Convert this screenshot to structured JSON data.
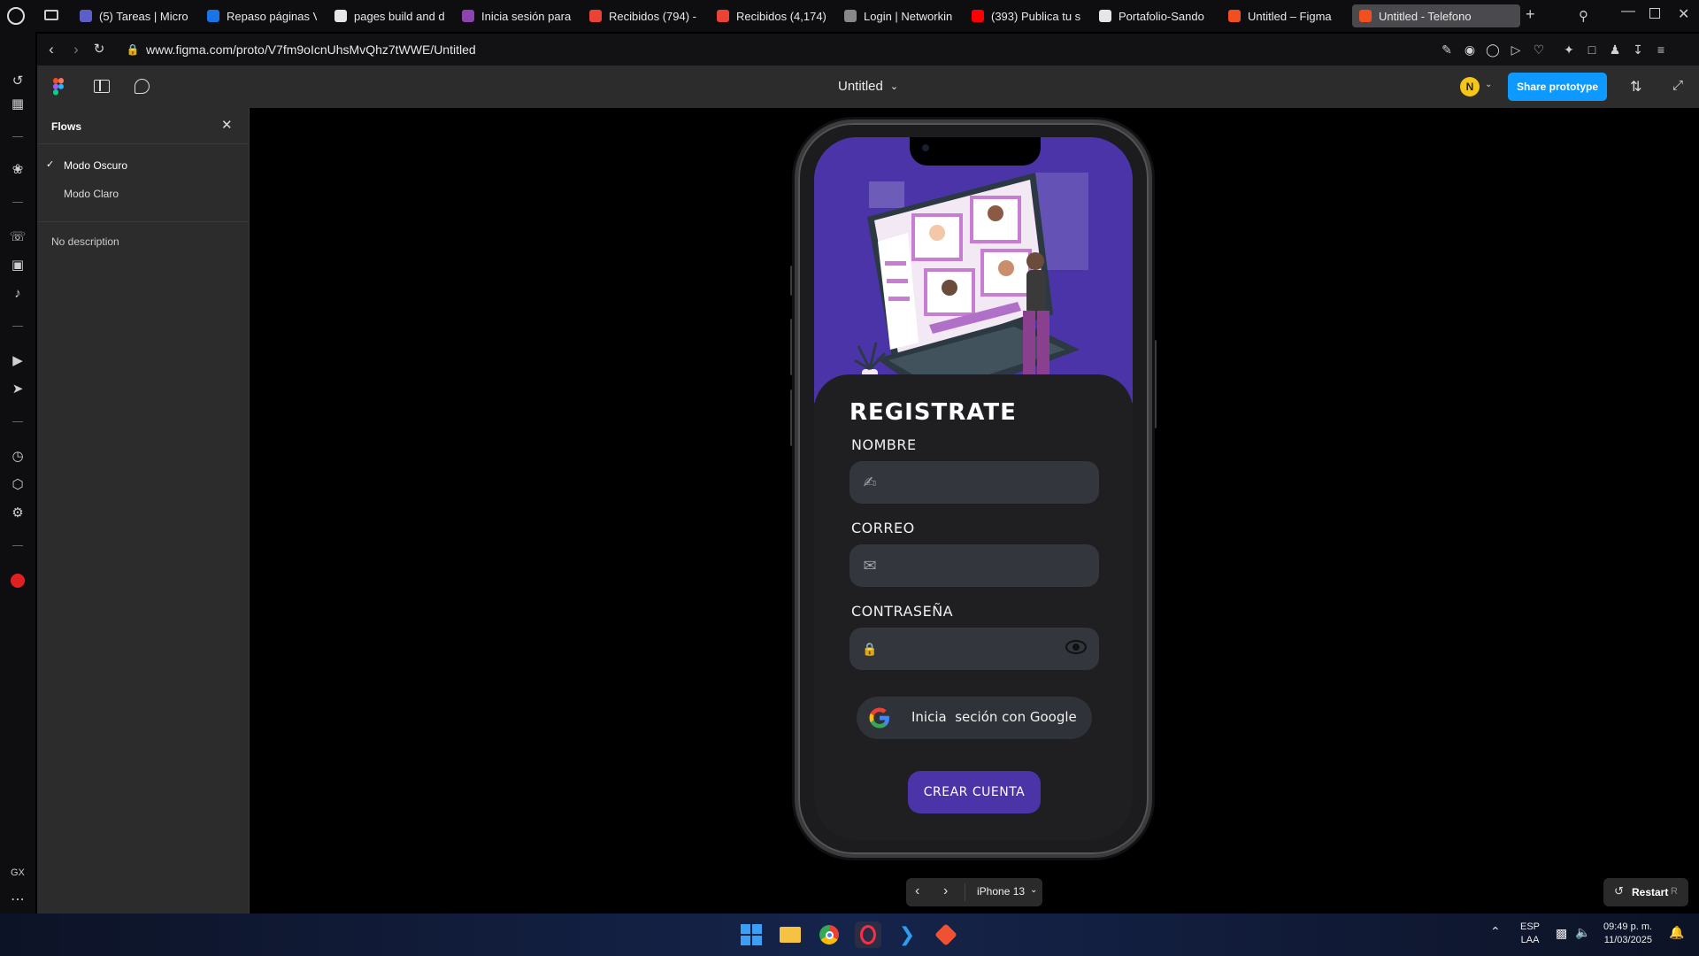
{
  "browser": {
    "tabs": [
      {
        "label": "(5) Tareas | Micro",
        "color": "#5b5fc7"
      },
      {
        "label": "Repaso páginas V",
        "color": "#1a73e8"
      },
      {
        "label": "pages build and d",
        "color": "#e6e6e6"
      },
      {
        "label": "Inicia sesión para",
        "color": "#8e44ad"
      },
      {
        "label": "Recibidos (794) -",
        "color": "#ea4335"
      },
      {
        "label": "Recibidos (4,174)",
        "color": "#ea4335"
      },
      {
        "label": "Login | Networkin",
        "color": "#888888"
      },
      {
        "label": "(393) Publica tu s",
        "color": "#ff0000"
      },
      {
        "label": "Portafolio-Sando",
        "color": "#e6e6e6"
      },
      {
        "label": "Untitled – Figma",
        "color": "#f24e1e"
      },
      {
        "label": "Untitled - Telefono",
        "color": "#f24e1e"
      }
    ],
    "url": "www.figma.com/proto/V7fm9oIcnUhsMvQhz7tWWE/Untitled",
    "new_tab_label": "+"
  },
  "figma": {
    "file_title": "Untitled",
    "avatar_initial": "N",
    "share_label": "Share prototype",
    "flows_title": "Flows",
    "flows": [
      {
        "label": "Modo Oscuro",
        "selected": true
      },
      {
        "label": "Modo Claro",
        "selected": false
      }
    ],
    "description": "No description",
    "device_label": "iPhone 13",
    "restart_label": "Restart",
    "restart_shortcut": "R"
  },
  "app": {
    "title": "REGISTRATE",
    "name_label": "NOMBRE",
    "email_label": "CORREO",
    "password_label": "CONTRASEÑA",
    "google_label": "Inicia  seción con Google",
    "create_label": "CREAR CUENTA",
    "colors": {
      "hero": "#4a34a8",
      "button": "#4a34a8",
      "field": "#33363d",
      "bg": "#1f1f21"
    }
  },
  "taskbar": {
    "lang_top": "ESP",
    "lang_bottom": "LAA",
    "time": "09:49 p. m.",
    "date": "11/03/2025"
  },
  "sidebar_extra": {
    "gx_label": "GX"
  }
}
